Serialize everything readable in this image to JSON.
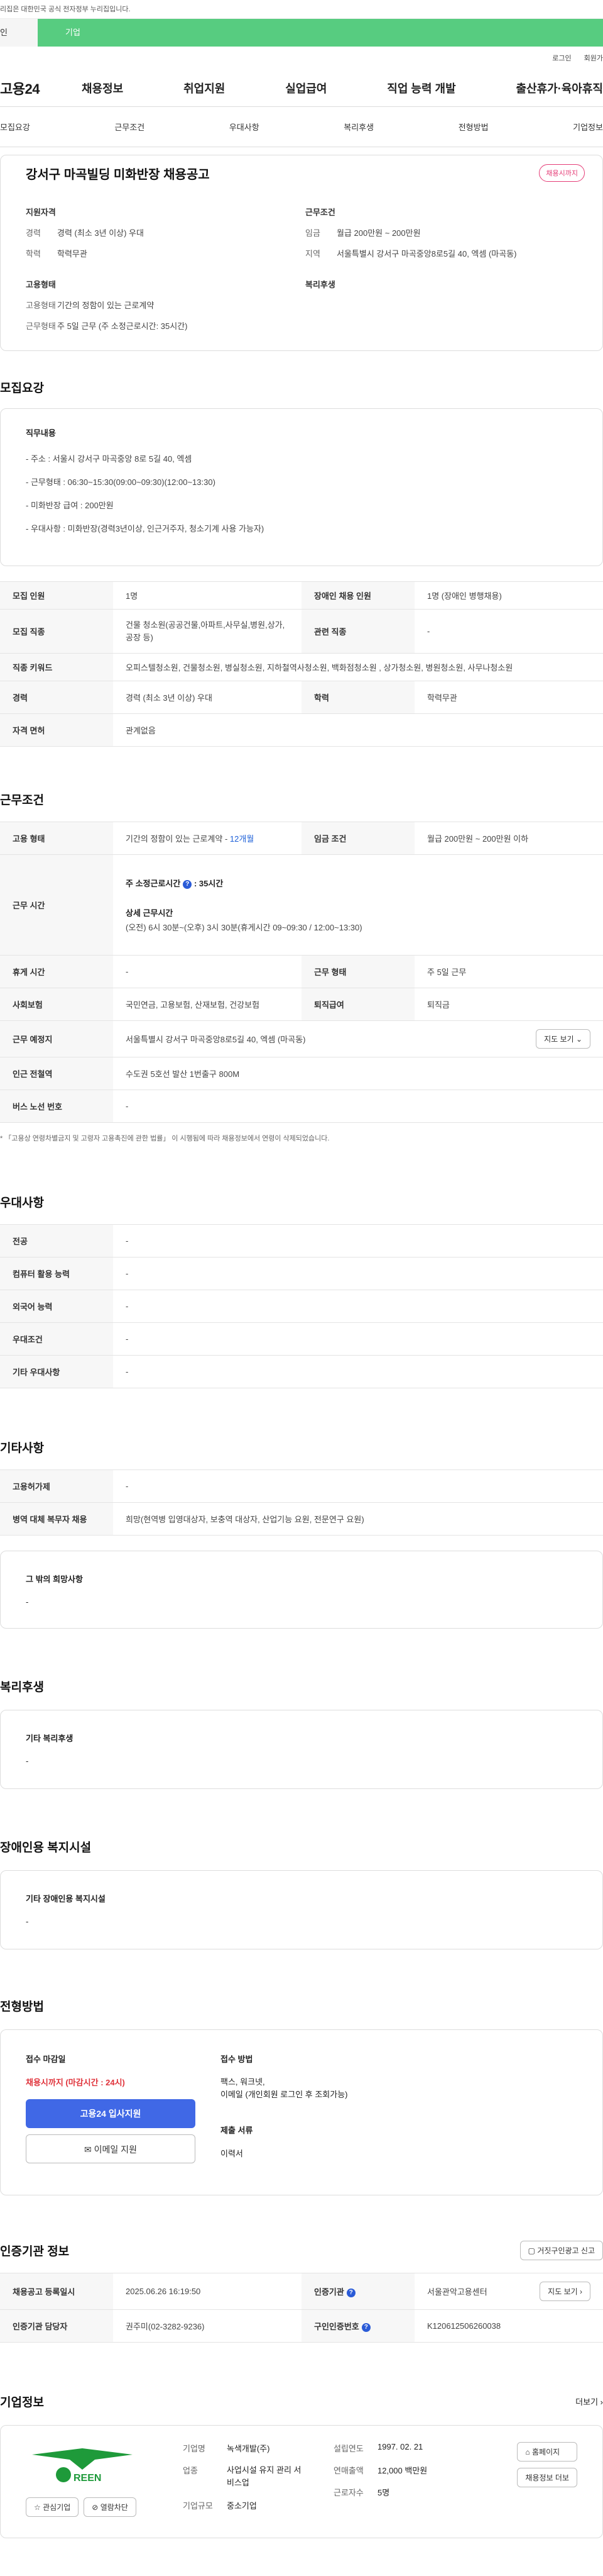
{
  "top_note": "리집은 대한민국 공식 전자정부 누리집입니다.",
  "tabs": {
    "individual": "인",
    "corporate": "기업"
  },
  "login": {
    "login": "로그인",
    "join": "회원가"
  },
  "gnb": {
    "logo": "고용24",
    "menu": [
      "채용정보",
      "취업지원",
      "실업급여",
      "직업 능력 개발",
      "출산휴가·육아휴직"
    ]
  },
  "subtabs": [
    "모집요강",
    "근무조건",
    "우대사항",
    "복리후생",
    "전형방법",
    "기업정보"
  ],
  "job": {
    "title": "강서구 마곡빌딩 미화반장 채용공고",
    "status_badge": "채용시까지",
    "qual_h": "지원자격",
    "qual": [
      {
        "k": "경력",
        "v": "경력 (최소 3년 이상) 우대"
      },
      {
        "k": "학력",
        "v": "학력무관"
      }
    ],
    "cond_h": "근무조건",
    "cond": [
      {
        "k": "임금",
        "v": "월급 200만원 ~ 200만원"
      },
      {
        "k": "지역",
        "v": "서울특별시 강서구 마곡중앙8로5길 40, 엑셈 (마곡동)"
      }
    ],
    "emp_h": "고용형태",
    "emp": [
      {
        "k": "고용형태",
        "v": "기간의 정함이 있는 근로계약"
      },
      {
        "k": "근무형태",
        "v": "주 5일 근무 (주 소정근로시간: 35시간)"
      }
    ],
    "welfare_h": "복리후생"
  },
  "recruit": {
    "heading": "모집요강",
    "duty_h": "직무내용",
    "duty_lines": [
      "- 주소 : 서울시 강서구 마곡중앙 8로 5길 40, 엑셈",
      "- 근무형태 : 06:30~15:30(09:00~09:30)(12:00~13:30)",
      "- 미화반장 급여 : 200만원",
      "- 우대사항 : 미화반장(경력3년이상, 인근거주자, 청소기계 사용 가능자)"
    ],
    "rows": [
      {
        "k1": "모집 인원",
        "v1": "1명",
        "k2": "장애인 채용 인원",
        "v2": "1명 (장애인 병행채용)"
      },
      {
        "k1": "모집 직종",
        "v1": "건물 청소원(공공건물,아파트,사무실,병원,상가,공장 등)",
        "k2": "관련 직종",
        "v2": "-"
      }
    ],
    "keyword_k": "직종 키워드",
    "keyword_v": "오피스텔청소원, 건물청소원, 병실청소원, 지하철역사청소원, 백화점청소원 , 상가청소원, 병원청소원, 사무나청소원",
    "career_k": "경력",
    "career_v": "경력 (최소 3년 이상) 우대",
    "edu_k": "학력",
    "edu_v": "학력무관",
    "license_k": "자격 면허",
    "license_v": "관계없음"
  },
  "work": {
    "heading": "근무조건",
    "emp_type_k": "고용 형태",
    "emp_type_v": "기간의 정함이 있는 근로계약 - ",
    "emp_type_months": "12개월",
    "wage_k": "임금 조건",
    "wage_v": "월급 200만원 ~ 200만원 이하",
    "hours_k": "근무 시간",
    "hours_std_label": "주 소정근로시간",
    "hours_std_v": ": 35시간",
    "hours_detail_label": "상세 근무시간",
    "hours_detail_v": "(오전) 6시 30분~(오후) 3시 30분(휴게시간 09~09:30 / 12:00~13:30)",
    "break_k": "휴게 시간",
    "break_v": "-",
    "form_k": "근무 형태",
    "form_v": "주 5일 근무",
    "insurance_k": "사회보험",
    "insurance_v": "국민연금, 고용보험, 산재보험, 건강보험",
    "retire_k": "퇴직급여",
    "retire_v": "퇴직금",
    "place_k": "근무 예정지",
    "place_v": "서울특별시 강서구 마곡중앙8로5길 40, 엑셈 (마곡동)",
    "map_btn": "지도 보기",
    "subway_k": "인근 전철역",
    "subway_v": "수도권 5호선 발산 1번출구 800M",
    "bus_k": "버스 노선 번호",
    "bus_v": "-",
    "note": "* 「고용상 연령차별금지 및 고령자 고용촉진에 관한 법률」 이 시행됨에 따라 채용정보에서 연령이 삭제되었습니다."
  },
  "pref": {
    "heading": "우대사항",
    "rows": [
      {
        "k": "전공",
        "v": "-"
      },
      {
        "k": "컴퓨터 활용 능력",
        "v": "-"
      },
      {
        "k": "외국어 능력",
        "v": "-"
      },
      {
        "k": "우대조건",
        "v": "-"
      },
      {
        "k": "기타 우대사항",
        "v": "-"
      }
    ]
  },
  "etc": {
    "heading": "기타사항",
    "rows": [
      {
        "k": "고용허가제",
        "v": "-"
      },
      {
        "k": "병역 대체 복무자 채용",
        "v": "희망(현역병 입영대상자, 보충역 대상자, 산업기능 요원, 전문연구 요원)"
      }
    ],
    "other_h": "그 밖의 희망사항",
    "other_v": "-"
  },
  "welfare": {
    "heading": "복리후생",
    "inner_h": "기타 복리후생",
    "inner_v": "-"
  },
  "disability": {
    "heading": "장애인용 복지시설",
    "inner_h": "기타 장애인용 복지시설",
    "inner_v": "-"
  },
  "selection": {
    "heading": "전형방법",
    "deadline_h": "접수 마감일",
    "deadline_v": "채용시까지 (마감시간 : 24시)",
    "apply_btn": "고용24 입사지원",
    "email_btn": "이메일 지원",
    "method_h": "접수 방법",
    "method_v": "팩스, 워크넷,",
    "method_v2": "이메일 (개인회원 로그인 후 조회가능)",
    "docs_h": "제출 서류",
    "docs_v": "이력서"
  },
  "cert": {
    "heading": "인증기관 정보",
    "report_btn": "거짓구인광고 신고",
    "rows": [
      {
        "k1": "채용공고 등록일시",
        "v1": "2025.06.26 16:19:50",
        "k2": "인증기관",
        "v2": "서울관악고용센터"
      },
      {
        "k1": "인증기관 담당자",
        "v1": "권주미(02-3282-9236)",
        "k2": "구인인증번호",
        "v2": "K120612506260038"
      }
    ],
    "map_btn": "지도 보기"
  },
  "company": {
    "heading": "기업정보",
    "more": "더보기",
    "logo_text": "REEN",
    "fav_btn": "관심기업",
    "block_btn": "열람차단",
    "info": [
      {
        "k": "기업명",
        "v": "녹색개발(주)"
      },
      {
        "k": "업종",
        "v": "사업시설 유지 관리 서비스업"
      },
      {
        "k": "기업규모",
        "v": "중소기업"
      }
    ],
    "info2": [
      {
        "k": "설립연도",
        "v": "1997. 02. 21"
      },
      {
        "k": "연매출액",
        "v": "12,000 백만원"
      },
      {
        "k": "근로자수",
        "v": "5명"
      }
    ],
    "homepage_btn": "홈페이지",
    "jobs_btn": "채용정보 더보"
  },
  "colors": {
    "brand_green": "#57cc80",
    "apply_blue": "#4068e6",
    "accent_red": "#e0323a",
    "badge_pink": "#e53d77"
  }
}
